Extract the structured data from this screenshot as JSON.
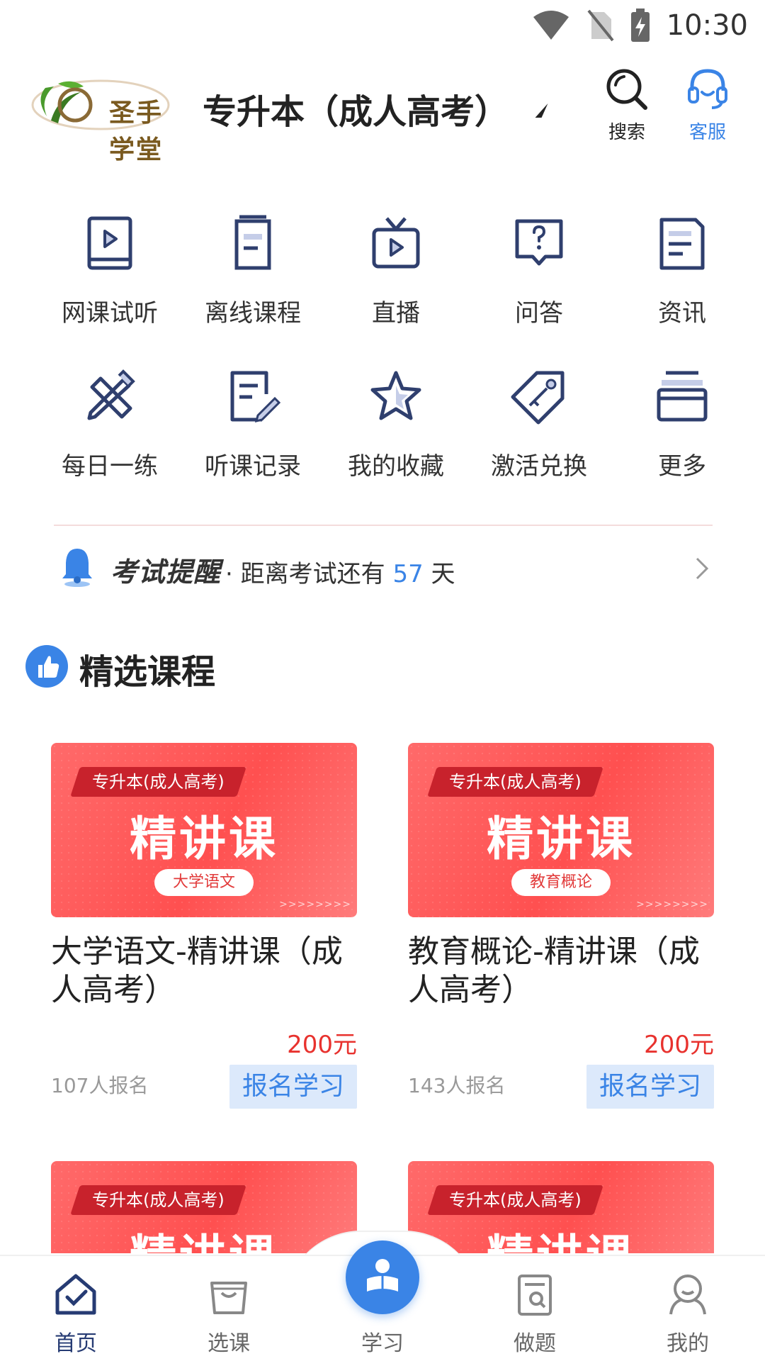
{
  "status": {
    "time": "10:30"
  },
  "header": {
    "logo_text": "圣手学堂",
    "title": "专升本（成人高考）",
    "search_label": "搜索",
    "service_label": "客服"
  },
  "grid": [
    {
      "label": "网课试听",
      "icon": "video-book-icon"
    },
    {
      "label": "离线课程",
      "icon": "offline-doc-icon"
    },
    {
      "label": "直播",
      "icon": "tv-play-icon"
    },
    {
      "label": "问答",
      "icon": "question-bubble-icon"
    },
    {
      "label": "资讯",
      "icon": "news-doc-icon"
    },
    {
      "label": "每日一练",
      "icon": "pencil-ruler-icon"
    },
    {
      "label": "听课记录",
      "icon": "record-edit-icon"
    },
    {
      "label": "我的收藏",
      "icon": "star-icon"
    },
    {
      "label": "激活兑换",
      "icon": "key-tag-icon"
    },
    {
      "label": "更多",
      "icon": "stack-box-icon"
    }
  ],
  "reminder": {
    "title": "考试提醒",
    "prefix": "· 距离考试还有 ",
    "days": "57",
    "suffix": " 天"
  },
  "section": {
    "title": "精选课程"
  },
  "courses": [
    {
      "tag": "专升本(成人高考)",
      "big": "精讲课",
      "subject": "大学语文",
      "title": "大学语文-精讲课（成人高考）",
      "price": "200元",
      "enrolled": "107人报名",
      "button": "报名学习"
    },
    {
      "tag": "专升本(成人高考)",
      "big": "精讲课",
      "subject": "教育概论",
      "title": "教育概论-精讲课（成人高考）",
      "price": "200元",
      "enrolled": "143人报名",
      "button": "报名学习"
    },
    {
      "tag": "专升本(成人高考)",
      "big": "精讲课"
    },
    {
      "tag": "专升本(成人高考)",
      "big": "精讲课"
    }
  ],
  "nav": {
    "home": "首页",
    "select": "选课",
    "study": "学习",
    "practice": "做题",
    "mine": "我的"
  },
  "colors": {
    "accent": "#3a84e6",
    "icon_navy": "#2f3f6e",
    "price_red": "#e8322e",
    "banner_red": "#ff5a5a"
  }
}
